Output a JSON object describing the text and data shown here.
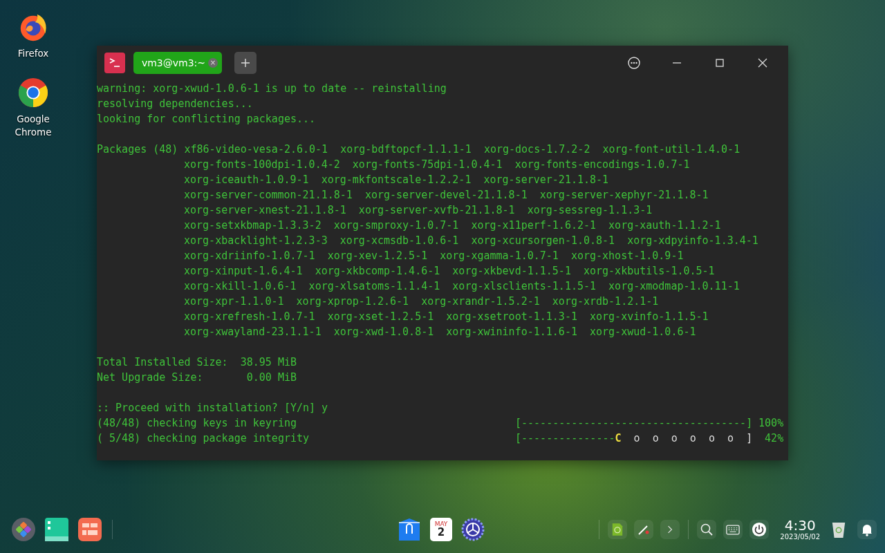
{
  "desktop_icons": [
    {
      "kind": "firefox",
      "label": "Firefox"
    },
    {
      "kind": "chrome",
      "label": "Google Chrome"
    }
  ],
  "terminal": {
    "tabs": [
      {
        "title": "vm3@vm3:~",
        "selected": true,
        "close": "×"
      }
    ],
    "lines": [
      {
        "kind": "text",
        "text": "warning: xorg-xwud-1.0.6-1 is up to date -- reinstalling"
      },
      {
        "kind": "text",
        "text": "resolving dependencies..."
      },
      {
        "kind": "text",
        "text": "looking for conflicting packages..."
      },
      {
        "kind": "blank"
      },
      {
        "kind": "text",
        "text": "Packages (48) xf86-video-vesa-2.6.0-1  xorg-bdftopcf-1.1.1-1  xorg-docs-1.7.2-2  xorg-font-util-1.4.0-1"
      },
      {
        "kind": "continuation",
        "text": "xorg-fonts-100dpi-1.0.4-2  xorg-fonts-75dpi-1.0.4-1  xorg-fonts-encodings-1.0.7-1"
      },
      {
        "kind": "continuation",
        "text": "xorg-iceauth-1.0.9-1  xorg-mkfontscale-1.2.2-1  xorg-server-21.1.8-1"
      },
      {
        "kind": "continuation",
        "text": "xorg-server-common-21.1.8-1  xorg-server-devel-21.1.8-1  xorg-server-xephyr-21.1.8-1"
      },
      {
        "kind": "continuation",
        "text": "xorg-server-xnest-21.1.8-1  xorg-server-xvfb-21.1.8-1  xorg-sessreg-1.1.3-1"
      },
      {
        "kind": "continuation",
        "text": "xorg-setxkbmap-1.3.3-2  xorg-smproxy-1.0.7-1  xorg-x11perf-1.6.2-1  xorg-xauth-1.1.2-1"
      },
      {
        "kind": "continuation",
        "text": "xorg-xbacklight-1.2.3-3  xorg-xcmsdb-1.0.6-1  xorg-xcursorgen-1.0.8-1  xorg-xdpyinfo-1.3.4-1"
      },
      {
        "kind": "continuation",
        "text": "xorg-xdriinfo-1.0.7-1  xorg-xev-1.2.5-1  xorg-xgamma-1.0.7-1  xorg-xhost-1.0.9-1"
      },
      {
        "kind": "continuation",
        "text": "xorg-xinput-1.6.4-1  xorg-xkbcomp-1.4.6-1  xorg-xkbevd-1.1.5-1  xorg-xkbutils-1.0.5-1"
      },
      {
        "kind": "continuation",
        "text": "xorg-xkill-1.0.6-1  xorg-xlsatoms-1.1.4-1  xorg-xlsclients-1.1.5-1  xorg-xmodmap-1.0.11-1"
      },
      {
        "kind": "continuation",
        "text": "xorg-xpr-1.1.0-1  xorg-xprop-1.2.6-1  xorg-xrandr-1.5.2-1  xorg-xrdb-1.2.1-1"
      },
      {
        "kind": "continuation",
        "text": "xorg-xrefresh-1.0.7-1  xorg-xset-1.2.5-1  xorg-xsetroot-1.1.3-1  xorg-xvinfo-1.1.5-1"
      },
      {
        "kind": "continuation",
        "text": "xorg-xwayland-23.1.1-1  xorg-xwd-1.0.8-1  xorg-xwininfo-1.1.6-1  xorg-xwud-1.0.6-1"
      },
      {
        "kind": "blank"
      },
      {
        "kind": "text",
        "text": "Total Installed Size:  38.95 MiB"
      },
      {
        "kind": "text",
        "text": "Net Upgrade Size:       0.00 MiB"
      },
      {
        "kind": "blank"
      },
      {
        "kind": "text",
        "text": ":: Proceed with installation? [Y/n] y"
      },
      {
        "kind": "progress",
        "label": "(48/48) checking keys in keyring",
        "bar": "[------------------------------------]",
        "percent": "100%"
      },
      {
        "kind": "progress",
        "label": "( 5/48) checking package integrity",
        "bar": "[---------------",
        "pacman": "C",
        "dots": "  o  o  o  o  o  o  ]",
        "percent": "42%"
      }
    ]
  },
  "taskbar": {
    "left": [
      {
        "kind": "launcher"
      },
      {
        "kind": "files"
      },
      {
        "kind": "multitask"
      }
    ],
    "center": [
      {
        "kind": "store"
      },
      {
        "kind": "calendar",
        "month": "MAY",
        "day": "2"
      },
      {
        "kind": "settings"
      }
    ],
    "tray": [
      {
        "kind": "sound"
      },
      {
        "kind": "pen"
      },
      {
        "kind": "chevron"
      }
    ],
    "system": [
      {
        "kind": "search"
      },
      {
        "kind": "keyboard"
      },
      {
        "kind": "power"
      }
    ],
    "clock": {
      "time": "4:30",
      "date": "2023/05/02"
    },
    "end": [
      {
        "kind": "trash"
      },
      {
        "kind": "bell"
      }
    ]
  }
}
